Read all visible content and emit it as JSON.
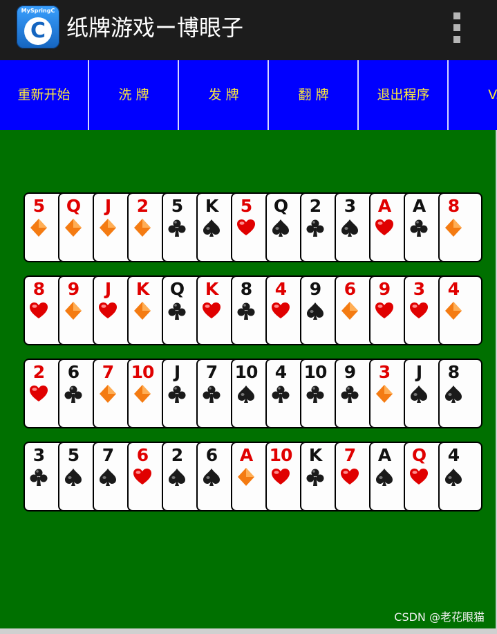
{
  "app": {
    "icon_brand": "MySpringC",
    "icon_letter": "C",
    "title": "纸牌游戏ー博眼子"
  },
  "toolbar": {
    "buttons": [
      "重新开始",
      "洗  牌",
      "发  牌",
      "翻  牌",
      "退出程序",
      "V."
    ]
  },
  "colors": {
    "red": "#e00000",
    "black": "#111111",
    "table_green": "#007000",
    "toolbar_blue": "#0000ff",
    "button_text": "#ffeb3b"
  },
  "rows": [
    [
      [
        "5",
        "diamond"
      ],
      [
        "Q",
        "diamond"
      ],
      [
        "J",
        "diamond"
      ],
      [
        "2",
        "diamond"
      ],
      [
        "5",
        "club"
      ],
      [
        "K",
        "spade"
      ],
      [
        "5",
        "heart"
      ],
      [
        "Q",
        "spade"
      ],
      [
        "2",
        "club"
      ],
      [
        "3",
        "spade"
      ],
      [
        "A",
        "heart"
      ],
      [
        "A",
        "club"
      ],
      [
        "8",
        "diamond"
      ]
    ],
    [
      [
        "8",
        "heart"
      ],
      [
        "9",
        "diamond"
      ],
      [
        "J",
        "heart"
      ],
      [
        "K",
        "diamond"
      ],
      [
        "Q",
        "club"
      ],
      [
        "K",
        "heart"
      ],
      [
        "8",
        "club"
      ],
      [
        "4",
        "heart"
      ],
      [
        "9",
        "spade"
      ],
      [
        "6",
        "diamond"
      ],
      [
        "9",
        "heart"
      ],
      [
        "3",
        "heart"
      ],
      [
        "4",
        "diamond"
      ]
    ],
    [
      [
        "2",
        "heart"
      ],
      [
        "6",
        "club"
      ],
      [
        "7",
        "diamond"
      ],
      [
        "10",
        "diamond"
      ],
      [
        "J",
        "club"
      ],
      [
        "7",
        "club"
      ],
      [
        "10",
        "spade"
      ],
      [
        "4",
        "club"
      ],
      [
        "10",
        "club"
      ],
      [
        "9",
        "club"
      ],
      [
        "3",
        "diamond"
      ],
      [
        "J",
        "spade"
      ],
      [
        "8",
        "spade"
      ]
    ],
    [
      [
        "3",
        "club"
      ],
      [
        "5",
        "spade"
      ],
      [
        "7",
        "spade"
      ],
      [
        "6",
        "heart"
      ],
      [
        "2",
        "spade"
      ],
      [
        "6",
        "spade"
      ],
      [
        "A",
        "diamond"
      ],
      [
        "10",
        "heart"
      ],
      [
        "K",
        "club"
      ],
      [
        "7",
        "heart"
      ],
      [
        "A",
        "spade"
      ],
      [
        "Q",
        "heart"
      ],
      [
        "4",
        "spade"
      ]
    ]
  ],
  "watermark": "CSDN @老花眼猫"
}
